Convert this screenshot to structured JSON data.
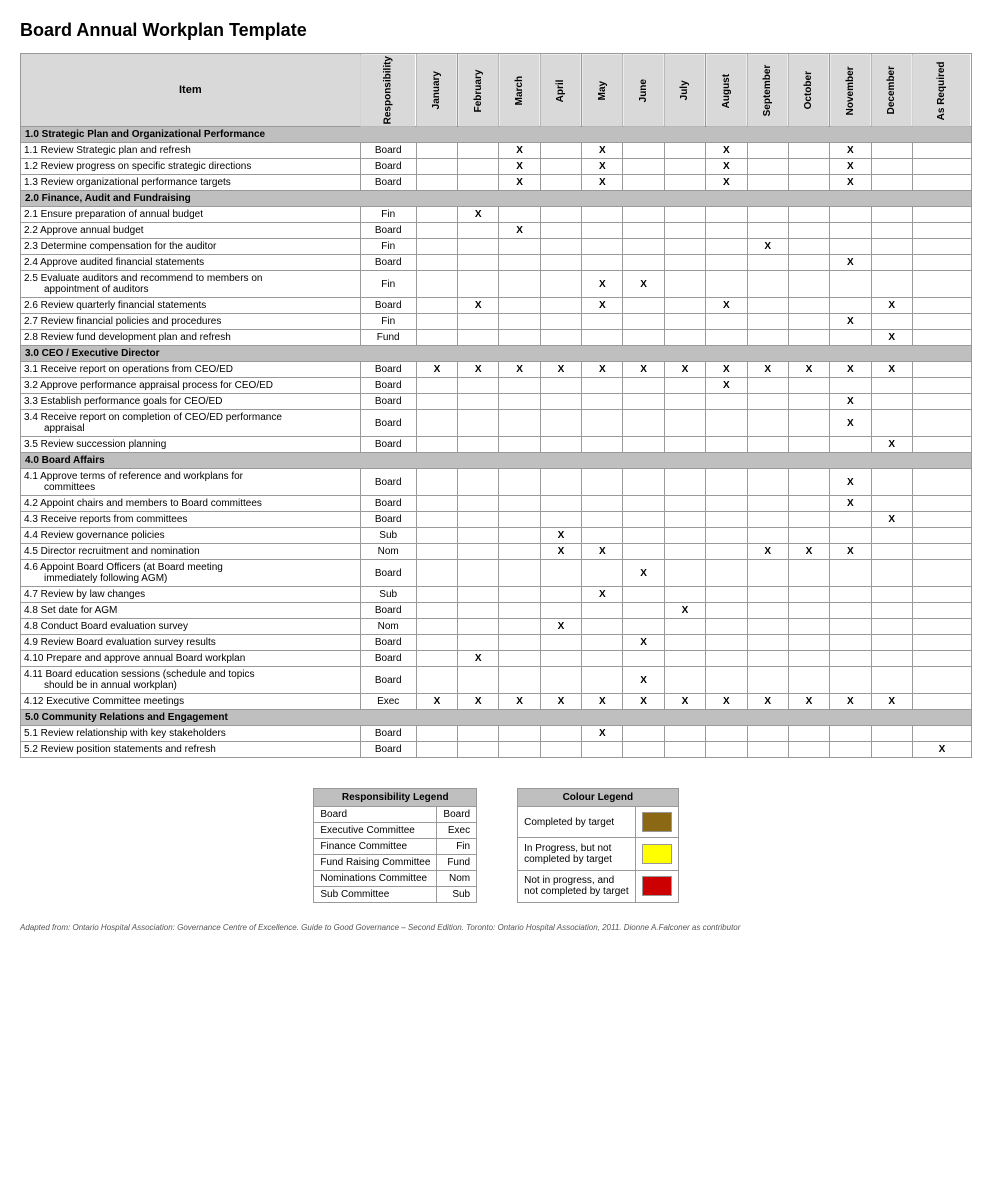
{
  "title": "Board Annual Workplan Template",
  "table": {
    "headers": {
      "item": "Item",
      "responsibility": "Responsibility",
      "months": [
        "January",
        "February",
        "March",
        "April",
        "May",
        "June",
        "July",
        "August",
        "September",
        "October",
        "November",
        "December",
        "As Required"
      ]
    },
    "sections": [
      {
        "id": "1.0",
        "title": "1.0 Strategic Plan and Organizational Performance",
        "rows": [
          {
            "item": "1.1 Review Strategic plan and refresh",
            "resp": "Board",
            "marks": {
              "March": "X",
              "May": "X",
              "August": "X",
              "November": "X"
            }
          },
          {
            "item": "1.2 Review progress on specific strategic directions",
            "resp": "Board",
            "marks": {
              "March": "X",
              "May": "X",
              "August": "X",
              "November": "X"
            }
          },
          {
            "item": "1.3 Review organizational performance targets",
            "resp": "Board",
            "marks": {
              "March": "X",
              "May": "X",
              "August": "X",
              "November": "X"
            }
          }
        ]
      },
      {
        "id": "2.0",
        "title": "2.0 Finance, Audit and Fundraising",
        "rows": [
          {
            "item": "2.1 Ensure preparation of annual budget",
            "resp": "Fin",
            "marks": {
              "February": "X"
            }
          },
          {
            "item": "2.2 Approve annual budget",
            "resp": "Board",
            "marks": {
              "March": "X"
            }
          },
          {
            "item": "2.3 Determine compensation for the auditor",
            "resp": "Fin",
            "marks": {
              "September": "X"
            }
          },
          {
            "item": "2.4 Approve audited financial statements",
            "resp": "Board",
            "marks": {
              "November": "X"
            }
          },
          {
            "item": "2.5 Evaluate auditors and recommend to members on     appointment of auditors",
            "resp": "Fin",
            "marks": {
              "May": "X",
              "June": "X"
            },
            "multiline": true
          },
          {
            "item": "2.6 Review quarterly financial statements",
            "resp": "Board",
            "marks": {
              "February": "X",
              "May": "X",
              "August": "X",
              "December": "X"
            }
          },
          {
            "item": "2.7 Review financial policies and procedures",
            "resp": "Fin",
            "marks": {
              "November": "X"
            }
          },
          {
            "item": "2.8 Review fund development plan and refresh",
            "resp": "Fund",
            "marks": {
              "December": "X"
            }
          }
        ]
      },
      {
        "id": "3.0",
        "title": "3.0 CEO / Executive Director",
        "rows": [
          {
            "item": "3.1 Receive report on operations from CEO/ED",
            "resp": "Board",
            "marks": {
              "January": "X",
              "February": "X",
              "March": "X",
              "April": "X",
              "May": "X",
              "June": "X",
              "July": "X",
              "August": "X",
              "September": "X",
              "October": "X",
              "November": "X",
              "December": "X"
            }
          },
          {
            "item": "3.2 Approve performance appraisal process for CEO/ED",
            "resp": "Board",
            "marks": {
              "August": "X"
            }
          },
          {
            "item": "3.3 Establish performance goals for CEO/ED",
            "resp": "Board",
            "marks": {
              "November": "X"
            }
          },
          {
            "item": "3.4 Receive report on completion of CEO/ED performance     appraisal",
            "resp": "Board",
            "marks": {
              "November": "X"
            },
            "multiline": true
          },
          {
            "item": "3.5 Review succession planning",
            "resp": "Board",
            "marks": {
              "December": "X"
            }
          }
        ]
      },
      {
        "id": "4.0",
        "title": "4.0 Board Affairs",
        "rows": [
          {
            "item": "4.1 Approve terms of reference and workplans for     committees",
            "resp": "Board",
            "marks": {
              "November": "X"
            },
            "multiline": true
          },
          {
            "item": "4.2 Appoint chairs and members to Board committees",
            "resp": "Board",
            "marks": {
              "November": "X"
            }
          },
          {
            "item": "4.3 Receive reports from committees",
            "resp": "Board",
            "marks": {
              "December": "X"
            }
          },
          {
            "item": "4.4 Review governance policies",
            "resp": "Sub",
            "marks": {
              "April": "X"
            }
          },
          {
            "item": "4.5 Director recruitment and nomination",
            "resp": "Nom",
            "marks": {
              "April": "X",
              "May": "X",
              "September": "X",
              "October": "X",
              "November": "X"
            }
          },
          {
            "item": "4.6 Appoint Board Officers (at Board meeting     immediately following AGM)",
            "resp": "Board",
            "marks": {
              "June": "X"
            },
            "multiline": true
          },
          {
            "item": "4.7 Review by law changes",
            "resp": "Sub",
            "marks": {
              "May": "X"
            }
          },
          {
            "item": "4.8 Set date for AGM",
            "resp": "Board",
            "marks": {
              "July": "X"
            }
          },
          {
            "item": "4.8 Conduct Board evaluation survey",
            "resp": "Nom",
            "marks": {
              "April": "X"
            }
          },
          {
            "item": "4.9 Review Board evaluation survey results",
            "resp": "Board",
            "marks": {
              "June": "X"
            }
          },
          {
            "item": "4.10 Prepare and approve annual Board workplan",
            "resp": "Board",
            "marks": {
              "February": "X"
            }
          },
          {
            "item": "4.11 Board education sessions (schedule and topics     should be in annual workplan)",
            "resp": "Board",
            "marks": {
              "June": "X"
            },
            "multiline": true
          },
          {
            "item": "4.12 Executive Committee meetings",
            "resp": "Exec",
            "marks": {
              "January": "X",
              "February": "X",
              "March": "X",
              "April": "X",
              "May": "X",
              "June": "X",
              "July": "X",
              "August": "X",
              "September": "X",
              "October": "X",
              "November": "X",
              "December": "X"
            }
          }
        ]
      },
      {
        "id": "5.0",
        "title": "5.0 Community Relations and Engagement",
        "rows": [
          {
            "item": "5.1 Review relationship with key stakeholders",
            "resp": "Board",
            "marks": {
              "May": "X"
            }
          },
          {
            "item": "5.2 Review position statements and refresh",
            "resp": "Board",
            "marks": {
              "As Required": "X"
            }
          }
        ]
      }
    ]
  },
  "responsibility_legend": {
    "title": "Responsibility Legend",
    "items": [
      {
        "label": "Board",
        "abbr": "Board"
      },
      {
        "label": "Executive Committee",
        "abbr": "Exec"
      },
      {
        "label": "Finance Committee",
        "abbr": "Fin"
      },
      {
        "label": "Fund Raising Committee",
        "abbr": "Fund"
      },
      {
        "label": "Nominations Committee",
        "abbr": "Nom"
      },
      {
        "label": "Sub Committee",
        "abbr": "Sub"
      }
    ]
  },
  "colour_legend": {
    "title": "Colour Legend",
    "items": [
      {
        "label": "Completed by target",
        "swatch": "brown"
      },
      {
        "label": "In Progress, but not\ncompleted by target",
        "swatch": "yellow"
      },
      {
        "label": "Not in progress, and\nnot completed by target",
        "swatch": "red"
      }
    ]
  },
  "footnote": "Adapted from: Ontario Hospital Association: Governance Centre of Excellence. Guide to Good Governance – Second Edition. Toronto: Ontario Hospital Association, 2011. Dionne A.Falconer as contributor"
}
